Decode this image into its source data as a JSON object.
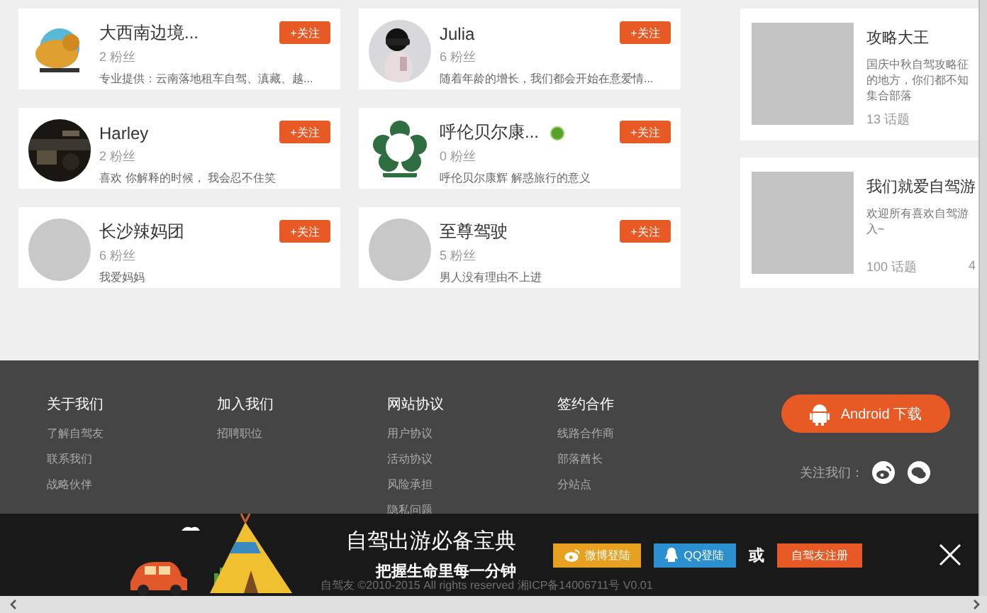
{
  "users": [
    {
      "name": "大西南边境...",
      "fans": "2 粉丝",
      "bio": "专业提供：云南落地租车自驾、滇藏、越...",
      "kind": "picture",
      "verified": false,
      "follow": "+关注"
    },
    {
      "name": "Julia",
      "fans": "6 粉丝",
      "bio": "随着年龄的增长，我们都会开始在意爱情...",
      "kind": "picture",
      "verified": false,
      "follow": "+关注"
    },
    {
      "name": "Harley",
      "fans": "2 粉丝",
      "bio": "喜欢 你解释的时候， 我会忍不住笑",
      "kind": "picture",
      "verified": false,
      "follow": "+关注"
    },
    {
      "name": "呼伦贝尔康...",
      "fans": "0 粉丝",
      "bio": "呼伦贝尔康辉 解惑旅行的意义",
      "kind": "picture",
      "verified": true,
      "follow": "+关注"
    },
    {
      "name": "长沙辣妈团",
      "fans": "6 粉丝",
      "bio": "我爱妈妈",
      "kind": "placeholder",
      "verified": false,
      "follow": "+关注"
    },
    {
      "name": "至尊驾驶",
      "fans": "5 粉丝",
      "bio": "男人没有理由不上进",
      "kind": "placeholder",
      "verified": false,
      "follow": "+关注"
    }
  ],
  "groups": [
    {
      "title": "攻略大王",
      "desc": [
        "国庆中秋自驾攻略征",
        "的地方，你们都不知",
        "集合部落"
      ],
      "topics": "13 话题"
    },
    {
      "title": "我们就爱自驾游",
      "desc": [
        "欢迎所有喜欢自驾游",
        "入~"
      ],
      "topics": "100 话题",
      "column_3": "4"
    }
  ],
  "footer": {
    "columns": [
      {
        "heading": "关于我们",
        "links": [
          "了解自驾友",
          "联系我们",
          "战略伙伴"
        ]
      },
      {
        "heading": "加入我们",
        "links": [
          "招聘职位"
        ]
      },
      {
        "heading": "网站协议",
        "links": [
          "用户协议",
          "活动协议",
          "风险承担",
          "隐私问题"
        ]
      },
      {
        "heading": "签约合作",
        "links": [
          "线路合作商",
          "部落酋长",
          "分站点"
        ]
      }
    ],
    "android_button": "Android 下载",
    "follow_us": "关注我们：",
    "copyright": "自驾友 ©2010-2015 All rights reserved 湘ICP备14006711号 V0.01"
  },
  "banner": {
    "title": "自驾出游必备宝典",
    "subtitle": "把握生命里每一分钟",
    "buttons": [
      {
        "kind": "weibo",
        "label": "微博登陆"
      },
      {
        "kind": "qq",
        "label": "QQ登陆"
      },
      {
        "kind": "or",
        "label": "或"
      },
      {
        "kind": "register",
        "label": "自驾友注册"
      }
    ]
  }
}
